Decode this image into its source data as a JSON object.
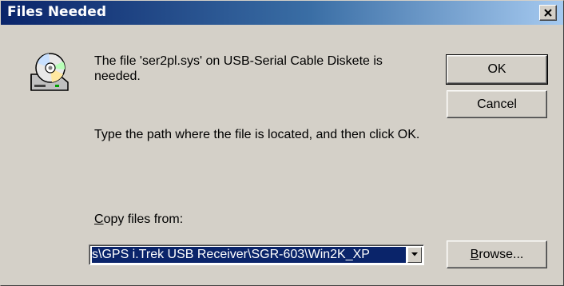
{
  "window": {
    "title": "Files Needed"
  },
  "message": {
    "line1": "The file 'ser2pl.sys' on USB-Serial Cable Diskete is needed.",
    "line2": "Type the path where the file is located, and then click OK."
  },
  "buttons": {
    "ok": "OK",
    "cancel": "Cancel",
    "browse_prefix": "B",
    "browse_rest": "rowse..."
  },
  "copy_from": {
    "label_prefix": "C",
    "label_rest": "opy files from:",
    "value": "s\\GPS i.Trek USB Receiver\\SGR-603\\Win2K_XP"
  },
  "icons": {
    "title_close": "close-icon",
    "disk": "disk-drive-icon",
    "dropdown": "chevron-down-icon"
  },
  "colors": {
    "title_bar_start": "#0a246a",
    "title_bar_end": "#a6caf0",
    "dialog_face": "#d4d0c8",
    "selection": "#0a246a"
  }
}
